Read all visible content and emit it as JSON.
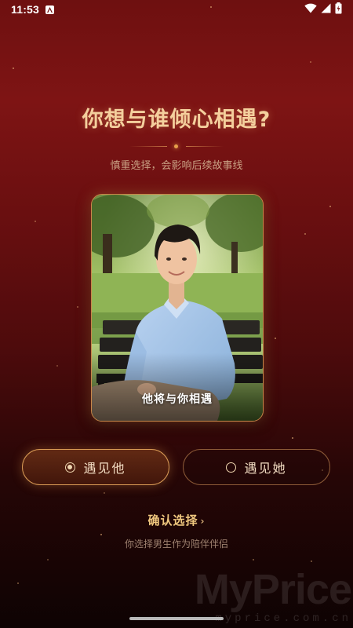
{
  "status_bar": {
    "time": "11:53",
    "notification_icon": "a-icon",
    "icons": [
      "wifi-icon",
      "signal-icon",
      "battery-icon"
    ]
  },
  "header": {
    "title": "你想与谁倾心相遇?",
    "subtitle": "慎重选择，会影响后续故事线"
  },
  "photo": {
    "caption": "他将与你相遇",
    "description_icon": "man-on-park-bench"
  },
  "choices": [
    {
      "label": "遇见他",
      "selected": true
    },
    {
      "label": "遇见她",
      "selected": false
    }
  ],
  "confirm": {
    "label": "确认选择",
    "chevron": "›"
  },
  "hint": "你选择男生作为陪伴伴侣",
  "watermark": {
    "main": "MyPrice",
    "sub": "myprice.com.cn"
  },
  "colors": {
    "accent": "#d89a55",
    "title": "#f4cf9d",
    "background_top": "#7e1414",
    "background_bottom": "#0e0303"
  }
}
